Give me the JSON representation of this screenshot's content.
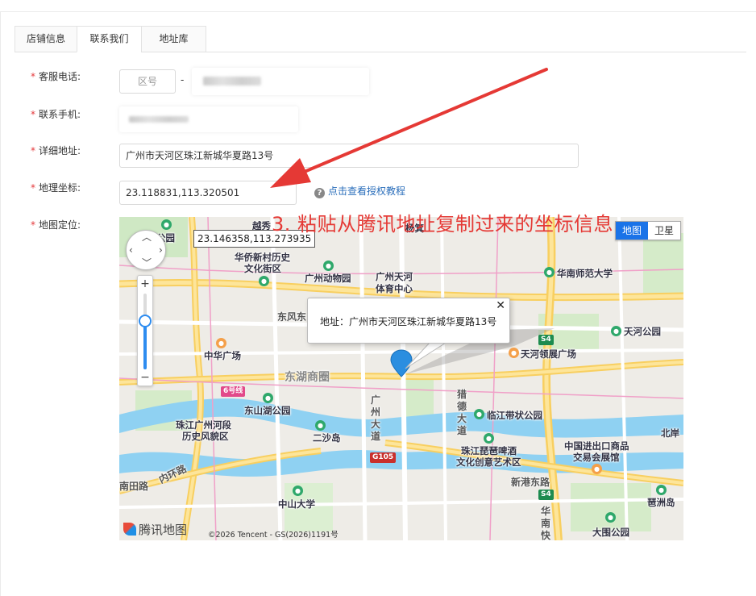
{
  "tabs": [
    {
      "label": "店铺信息"
    },
    {
      "label": "联系我们"
    },
    {
      "label": "地址库"
    }
  ],
  "active_tab": "联系我们",
  "form": {
    "phone": {
      "label": "客服电话:",
      "area_code_placeholder": "区号",
      "separator": "-"
    },
    "mobile": {
      "label": "联系手机:"
    },
    "address": {
      "label": "详细地址:",
      "value": "广州市天河区珠江新城华夏路13号"
    },
    "coords": {
      "label": "地理坐标:",
      "value": "23.118831,113.320501"
    },
    "map": {
      "label": "地图定位:"
    },
    "required_mark": "*"
  },
  "help_link": {
    "text": "点击查看授权教程",
    "icon": "question-circle-icon"
  },
  "annotation": "3. 粘贴从腾讯地址复制过来的坐标信息",
  "map": {
    "cursor_coords": "23.146358,113.273935",
    "map_type": {
      "map": "地图",
      "satellite": "卫星"
    },
    "info_window": {
      "text": "地址：广州市天河区珠江新城华夏路13号",
      "close": "✕"
    },
    "logo": "腾讯地图",
    "copyright": "©2026 Tencent - GS(2026)1191号",
    "zoom_in": "+",
    "zoom_out": "−",
    "labels": {
      "guangyuan_park": "公园",
      "yuexiu": "越秀",
      "yangji": "杨箕",
      "huaqiao": "华侨新村历史",
      "huaqiao2": "文化街区",
      "zoo": "广州动物园",
      "tianhe_stadium": "广州天河",
      "tianhe_stadium2": "体育中心",
      "scnu": "华南师范大学",
      "dongfeng": "东风东",
      "tianhe_park": "天河公园",
      "zhonghua": "中华广场",
      "tianhe_expo": "天河领展广场",
      "donghu": "东湖商圈",
      "line6": "6号线",
      "dongshanhu": "东山湖公园",
      "zhujiang_hedao": "珠江广州河段",
      "zhujiang_hedao2": "历史风貌区",
      "ershadao": "二沙岛",
      "guangzhou_dadao": "广州大道",
      "liede": "猎德大道",
      "linjiang": "临江带状公园",
      "beer": "珠江琵琶啤酒",
      "beer2": "文化创意艺术区",
      "cieec": "中国进出口商品",
      "cieec2": "交易会展馆",
      "beidong": "北岸",
      "g105": "G105",
      "nantian": "南田路",
      "neihuan": "内环路",
      "xingang": "新港东路",
      "zhongshan": "中山大学",
      "s4a": "S4",
      "s4b": "S4",
      "huanan": "华南快",
      "pazhou": "琶洲岛",
      "dawei": "大围公园"
    }
  }
}
